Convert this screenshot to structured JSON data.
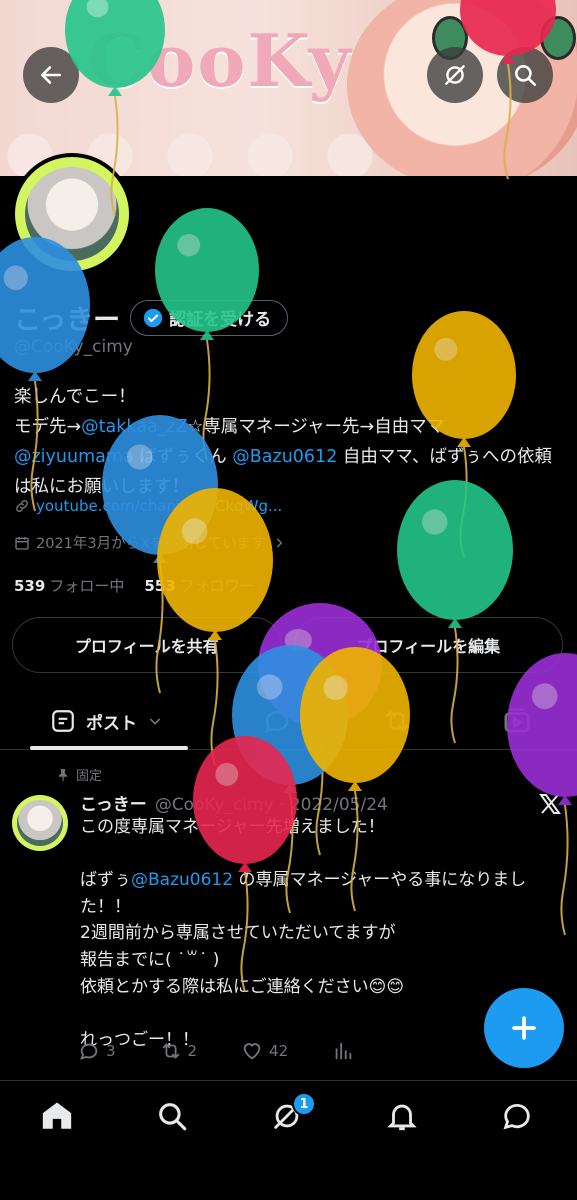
{
  "banner": {
    "logo_text": "CooKy"
  },
  "profile": {
    "name": "こっきー",
    "verify_label": "認証を受ける",
    "handle": "@CooKy_cimy",
    "bio_line1": "楽しんでこー！",
    "bio_line2_pre": "モデ先→",
    "bio_mention1": "@takkaa_zZ",
    "bio_line2_post": "☆専属マネージャー先→自由ママ",
    "bio_mention2": "@ziyuumama",
    "bio_line3_mid": " ばずぅくん ",
    "bio_mention3": "@Bazu0612",
    "bio_line3_post": " 自由ママ、ばずぅへの依頼は私にお願いします！",
    "link_text": "youtube.com/channel/UCkqWg...",
    "joined_text": "2021年3月からXを利用しています",
    "following_count": "539",
    "following_label": "フォロー中",
    "followers_count": "553",
    "followers_label": "フォロワー"
  },
  "buttons": {
    "share": "プロフィールを共有",
    "edit": "プロフィールを編集"
  },
  "tabs": {
    "posts": "ポスト"
  },
  "post": {
    "pinned_label": "固定",
    "author": "こっきー",
    "handle_date": "@CooKy_cimy · 2022/05/24",
    "line1": "この度専属マネージャー先増えました！",
    "line2_pre": "ばずぅ",
    "line2_mention": "@Bazu0612",
    "line2_post": " の専属マネージャーやる事になりました！！",
    "line3": "2週間前から専属させていただいてますが",
    "line4": "報告までに( ˙꒳˙ )",
    "line5": "依頼とかする際は私にご連絡ください😊😊",
    "line6": "れっつごー！！",
    "replies": "3",
    "reposts": "2",
    "likes": "42"
  },
  "nav": {
    "notification_badge": "1"
  },
  "colors": {
    "accent": "#1d9bf0",
    "balloon_green": "#25c58a",
    "balloon_yellow": "#f0b400",
    "balloon_blue": "#2e8fe0",
    "balloon_purple": "#9b2fd6",
    "balloon_red": "#e8264f"
  }
}
